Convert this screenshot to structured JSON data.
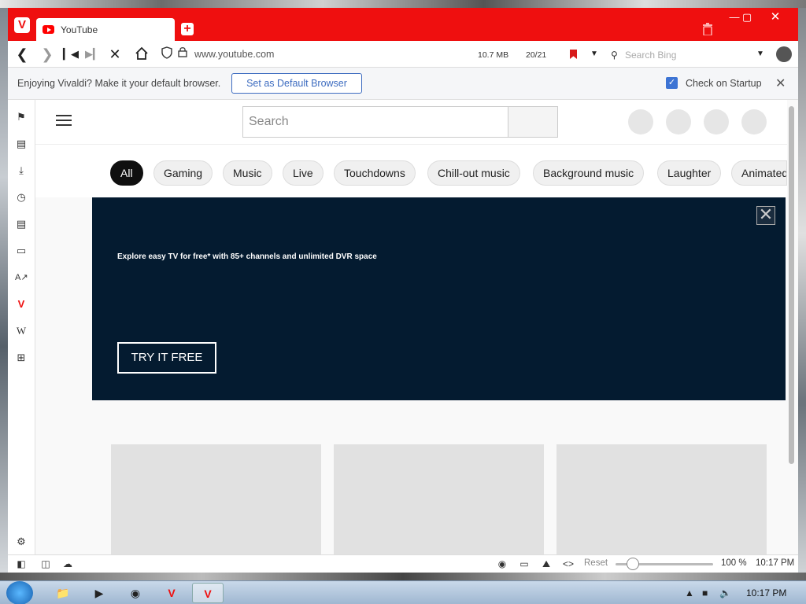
{
  "browser": {
    "tab_title": "YouTube",
    "url": "www.youtube.com",
    "memory": "10.7 MB",
    "tab_count": "20/21",
    "search_placeholder": "Search Bing"
  },
  "notice": {
    "text": "Enjoying Vivaldi? Make it your default browser.",
    "button": "Set as Default Browser",
    "checkbox_label": "Check on Startup"
  },
  "youtube": {
    "search_placeholder": "Search",
    "chips": [
      "All",
      "Gaming",
      "Music",
      "Live",
      "Touchdowns",
      "Chill-out music",
      "Background music",
      "Laughter",
      "Animated"
    ],
    "ad_text": "Explore easy TV for free* with 85+ channels and unlimited DVR space",
    "ad_button": "TRY IT FREE"
  },
  "statusbar": {
    "reset": "Reset",
    "zoom": "100 %",
    "time": "10:17 PM",
    "zoom_level_percent": 100
  },
  "taskbar": {
    "time": "10:17 PM"
  },
  "colors": {
    "vivaldi_red": "#ef0f0f",
    "ad_bg": "#041b30",
    "accent_blue": "#3d6cc0"
  }
}
